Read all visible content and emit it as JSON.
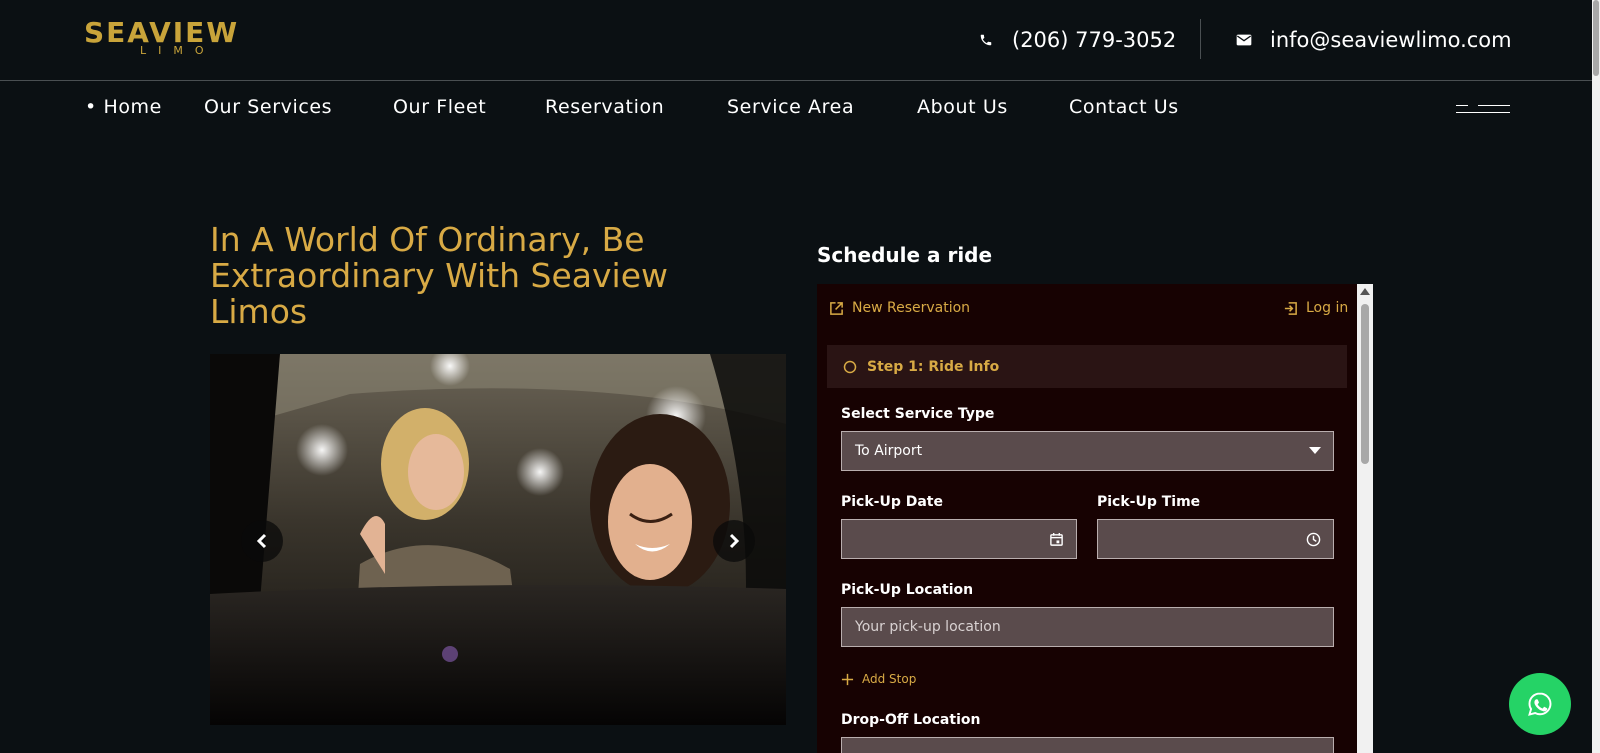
{
  "header": {
    "logo_main": "SEAVIEW",
    "logo_sub": "LIMO",
    "phone": "(206) 779-3052",
    "email": "info@seaviewlimo.com"
  },
  "nav": {
    "items": [
      "• Home",
      "Our Services",
      "Our Fleet",
      "Reservation",
      "Service Area",
      "About Us",
      "Contact Us"
    ]
  },
  "hero": {
    "headline": "In A World Of Ordinary, Be Extraordinary With Seaview Limos"
  },
  "form": {
    "title": "Schedule a ride",
    "new_reservation": "New Reservation",
    "login": "Log in",
    "step": "Step 1: Ride Info",
    "service_type_label": "Select Service Type",
    "service_type_value": "To Airport",
    "pickup_date_label": "Pick-Up Date",
    "pickup_time_label": "Pick-Up Time",
    "pickup_location_label": "Pick-Up Location",
    "pickup_location_placeholder": "Your pick-up location",
    "add_stop": "Add Stop",
    "dropoff_location_label": "Drop-Off Location"
  },
  "colors": {
    "accent_gold": "#d8aa45",
    "page_bg": "#0b1013",
    "form_bg": "#170202",
    "whatsapp": "#25d366"
  },
  "icons": [
    "phone-icon",
    "mail-icon",
    "menu-icon",
    "chevron-left-icon",
    "chevron-right-icon",
    "external-link-icon",
    "login-icon",
    "circle-icon",
    "caret-down-icon",
    "calendar-icon",
    "clock-icon",
    "plus-icon",
    "whatsapp-icon"
  ]
}
